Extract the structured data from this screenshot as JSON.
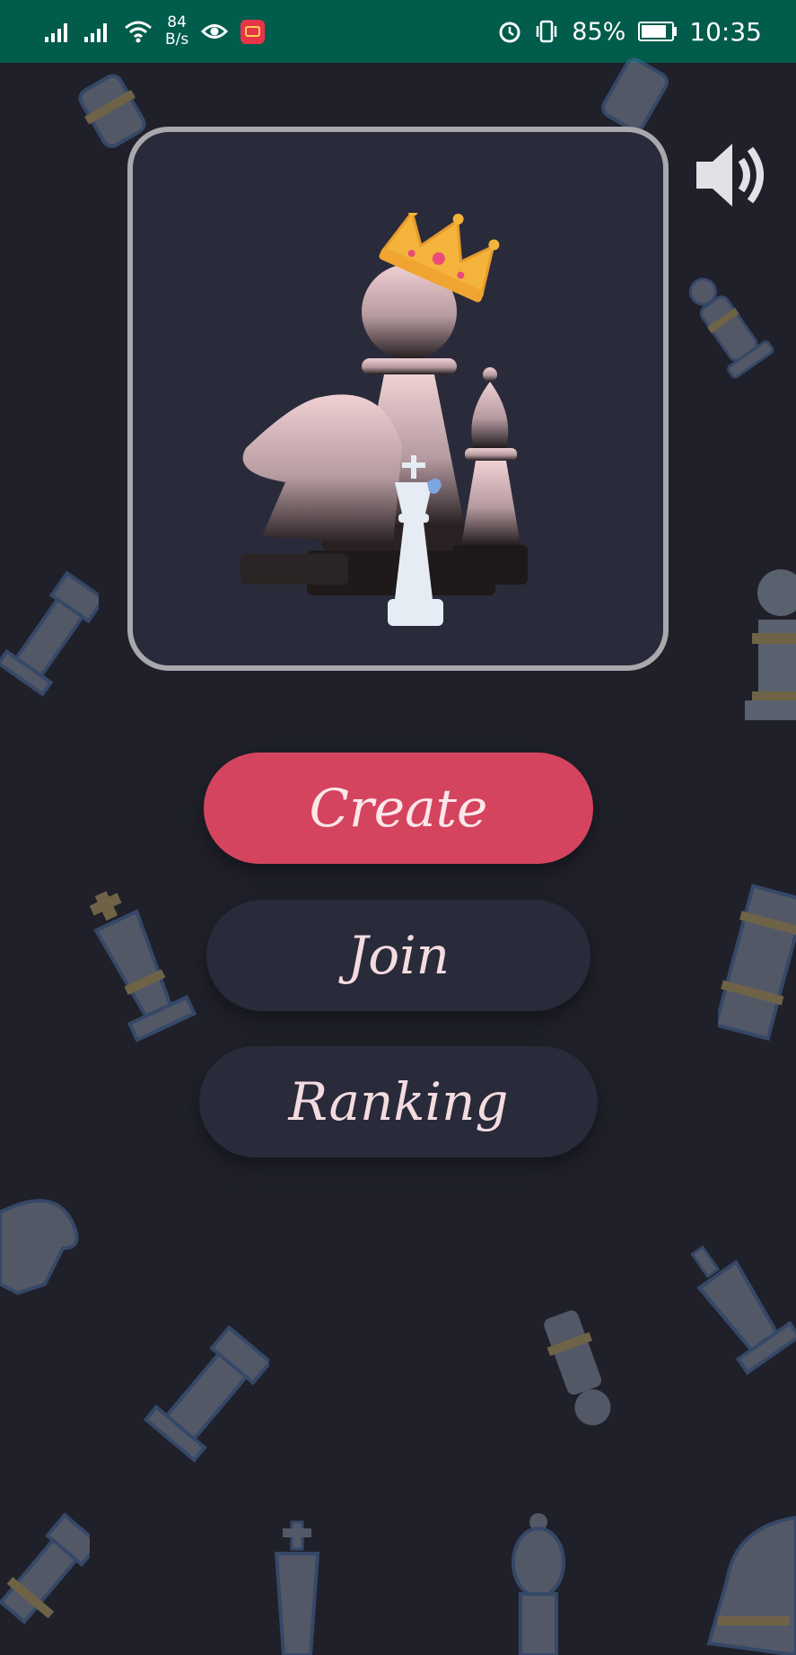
{
  "status_bar": {
    "network_speed_value": "84",
    "network_speed_unit": "B/s",
    "battery": "85%",
    "time": "10:35",
    "icons": [
      "signal-icon",
      "signal-icon",
      "wifi-icon",
      "eye-icon",
      "app-badge-icon",
      "alarm-icon",
      "vibrate-icon",
      "battery-icon"
    ]
  },
  "hero": {
    "image": "chess-pieces-with-crown-illustration"
  },
  "sound_button": {
    "icon": "speaker-icon"
  },
  "menu": {
    "create_label": "Create",
    "join_label": "Join",
    "ranking_label": "Ranking"
  },
  "colors": {
    "status_bar": "#025c4c",
    "background": "#1f2029",
    "card": "#2a2b3a",
    "card_border": "#a9a9ad",
    "create_button": "#d5445f",
    "secondary_button": "#292a3a",
    "button_text": "#f4dbe0"
  }
}
